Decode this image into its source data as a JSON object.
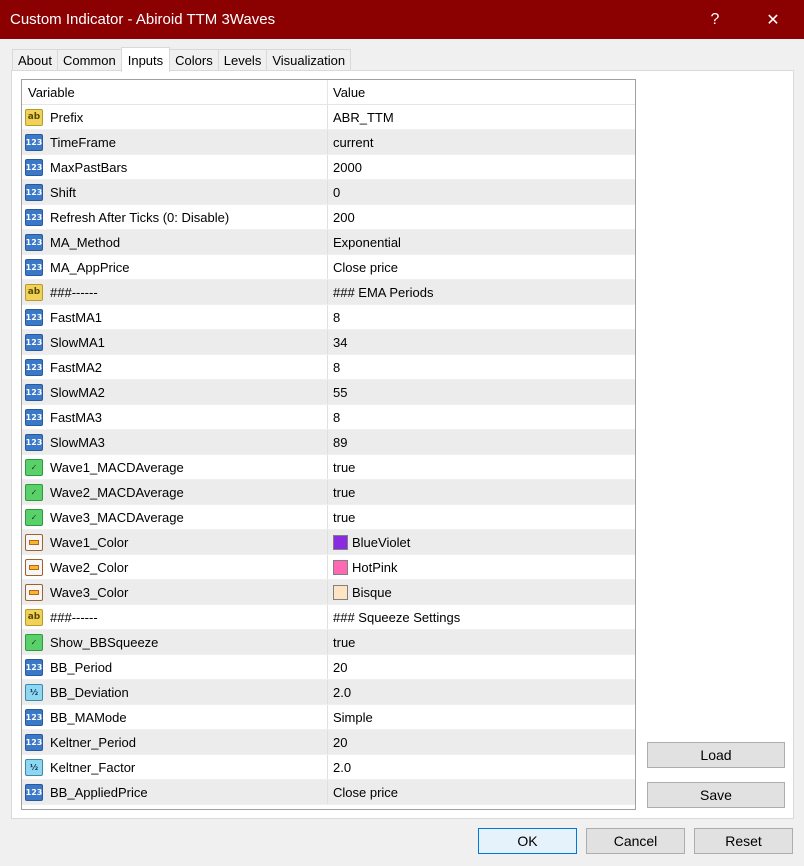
{
  "window": {
    "title": "Custom Indicator - Abiroid TTM 3Waves",
    "help_label": "?",
    "close_label": "✕"
  },
  "tabs": [
    {
      "label": "About"
    },
    {
      "label": "Common"
    },
    {
      "label": "Inputs"
    },
    {
      "label": "Colors"
    },
    {
      "label": "Levels"
    },
    {
      "label": "Visualization"
    }
  ],
  "grid": {
    "col_variable": "Variable",
    "col_value": "Value",
    "rows": [
      {
        "type": "str",
        "name": "Prefix",
        "value": "ABR_TTM"
      },
      {
        "type": "int",
        "name": "TimeFrame",
        "value": "current"
      },
      {
        "type": "int",
        "name": "MaxPastBars",
        "value": "2000"
      },
      {
        "type": "int",
        "name": "Shift",
        "value": "0"
      },
      {
        "type": "int",
        "name": "Refresh After Ticks (0: Disable)",
        "value": "200"
      },
      {
        "type": "int",
        "name": "MA_Method",
        "value": "Exponential"
      },
      {
        "type": "int",
        "name": "MA_AppPrice",
        "value": "Close price"
      },
      {
        "type": "str",
        "name": "###------",
        "value": "### EMA Periods"
      },
      {
        "type": "int",
        "name": "FastMA1",
        "value": "8"
      },
      {
        "type": "int",
        "name": "SlowMA1",
        "value": "34"
      },
      {
        "type": "int",
        "name": "FastMA2",
        "value": "8"
      },
      {
        "type": "int",
        "name": "SlowMA2",
        "value": "55"
      },
      {
        "type": "int",
        "name": "FastMA3",
        "value": "8"
      },
      {
        "type": "int",
        "name": "SlowMA3",
        "value": "89"
      },
      {
        "type": "bool",
        "name": "Wave1_MACDAverage",
        "value": "true"
      },
      {
        "type": "bool",
        "name": "Wave2_MACDAverage",
        "value": "true"
      },
      {
        "type": "bool",
        "name": "Wave3_MACDAverage",
        "value": "true"
      },
      {
        "type": "color",
        "name": "Wave1_Color",
        "value": "BlueViolet",
        "swatch": "#8a2be2"
      },
      {
        "type": "color",
        "name": "Wave2_Color",
        "value": "HotPink",
        "swatch": "#ff69b4"
      },
      {
        "type": "color",
        "name": "Wave3_Color",
        "value": "Bisque",
        "swatch": "#ffe4c4"
      },
      {
        "type": "str",
        "name": "###------",
        "value": "### Squeeze Settings"
      },
      {
        "type": "bool",
        "name": "Show_BBSqueeze",
        "value": "true"
      },
      {
        "type": "int",
        "name": "BB_Period",
        "value": "20"
      },
      {
        "type": "dbl",
        "name": "BB_Deviation",
        "value": "2.0"
      },
      {
        "type": "int",
        "name": "BB_MAMode",
        "value": "Simple"
      },
      {
        "type": "int",
        "name": "Keltner_Period",
        "value": "20"
      },
      {
        "type": "dbl",
        "name": "Keltner_Factor",
        "value": "2.0"
      },
      {
        "type": "int",
        "name": "BB_AppliedPrice",
        "value": "Close price"
      }
    ]
  },
  "icon_glyphs": {
    "int": "123",
    "str": "ab",
    "bool": "✓",
    "dbl": "½"
  },
  "side_buttons": {
    "load": "Load",
    "save": "Save"
  },
  "footer": {
    "ok": "OK",
    "cancel": "Cancel",
    "reset": "Reset"
  }
}
